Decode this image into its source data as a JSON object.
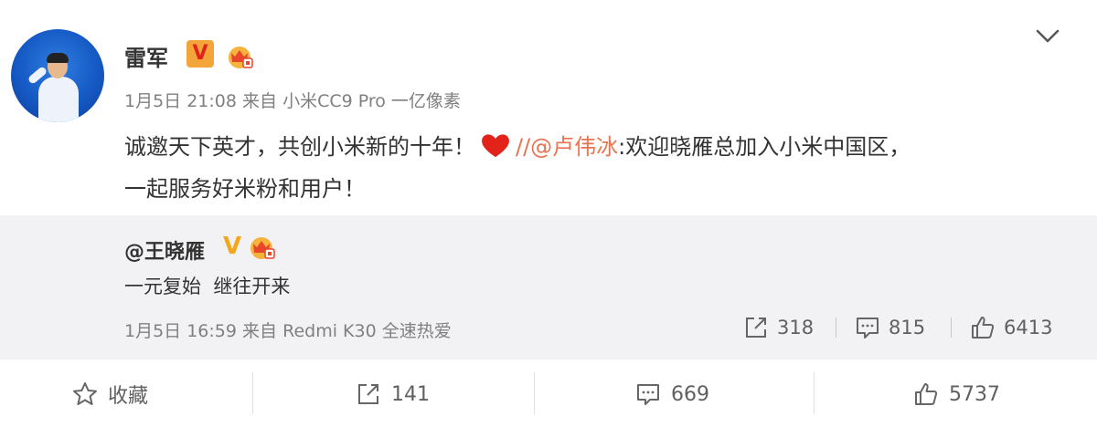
{
  "post": {
    "author": "雷军",
    "verified_badge": "V",
    "meta": {
      "date": "1月5日 21:08",
      "source_prefix": "来自",
      "device": "小米CC9 Pro 一亿像素"
    },
    "content": {
      "text": "诚邀天下英才，共创小米新的十年！",
      "separator": "//",
      "mention": "@卢伟冰",
      "colon_text": ":欢迎晓雁总加入小米中国区，",
      "line2": "一起服务好米粉和用户！"
    }
  },
  "repost": {
    "author": "@王晓雁",
    "verified_badge": "V",
    "text": "一元复始  继往开来",
    "meta": {
      "date": "1月5日 16:59",
      "source_prefix": "来自",
      "device": "Redmi K30 全速热爱"
    },
    "stats": {
      "share": "318",
      "comment": "815",
      "like": "6413"
    }
  },
  "footer": {
    "favorite_label": "收藏",
    "share_count": "141",
    "comment_count": "669",
    "like_count": "5737"
  },
  "colors": {
    "mention": "#eb7350",
    "repost_bg": "#f2f2f5",
    "badge_orange": "#f4a53a"
  }
}
